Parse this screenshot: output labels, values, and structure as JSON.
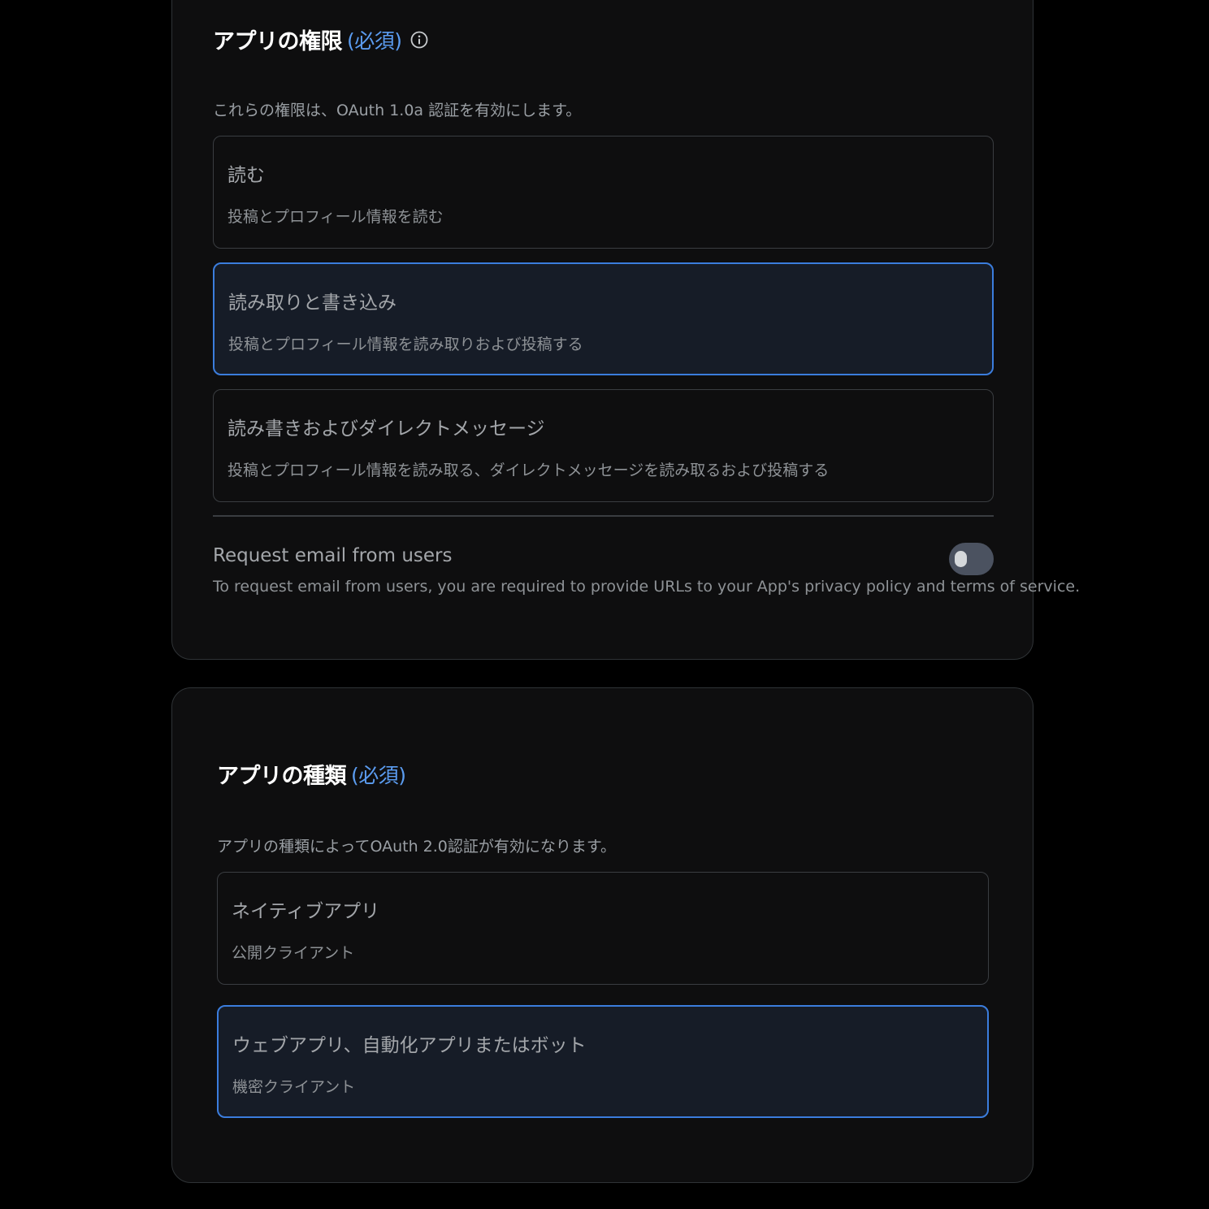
{
  "permissions": {
    "title": "アプリの権限",
    "required_label": "(必須)",
    "info_icon": "info-icon",
    "description": "これらの権限は、OAuth 1.0a 認証を有効にします。",
    "options": [
      {
        "title": "読む",
        "subtitle": "投稿とプロフィール情報を読む",
        "selected": false
      },
      {
        "title": "読み取りと書き込み",
        "subtitle": "投稿とプロフィール情報を読み取りおよび投稿する",
        "selected": true
      },
      {
        "title": "読み書きおよびダイレクトメッセージ",
        "subtitle": "投稿とプロフィール情報を読み取る、ダイレクトメッセージを読み取るおよび投稿する",
        "selected": false
      }
    ],
    "email": {
      "title": "Request email from users",
      "description": "To request email from users, you are required to provide URLs to your App's privacy policy and terms of service.",
      "enabled": false
    }
  },
  "app_type": {
    "title": "アプリの種類",
    "required_label": "(必須)",
    "description": "アプリの種類によってOAuth 2.0認証が有効になります。",
    "options": [
      {
        "title": "ネイティブアプリ",
        "subtitle": "公開クライアント",
        "selected": false
      },
      {
        "title": "ウェブアプリ、自動化アプリまたはボット",
        "subtitle": "機密クライアント",
        "selected": true
      }
    ]
  },
  "colors": {
    "accent": "#3b7ddd",
    "required": "#5b9cf0",
    "background": "#000000",
    "panel": "#0e0e0f",
    "selected_bg": "#161c27",
    "toggle_off": "#4b5260"
  }
}
